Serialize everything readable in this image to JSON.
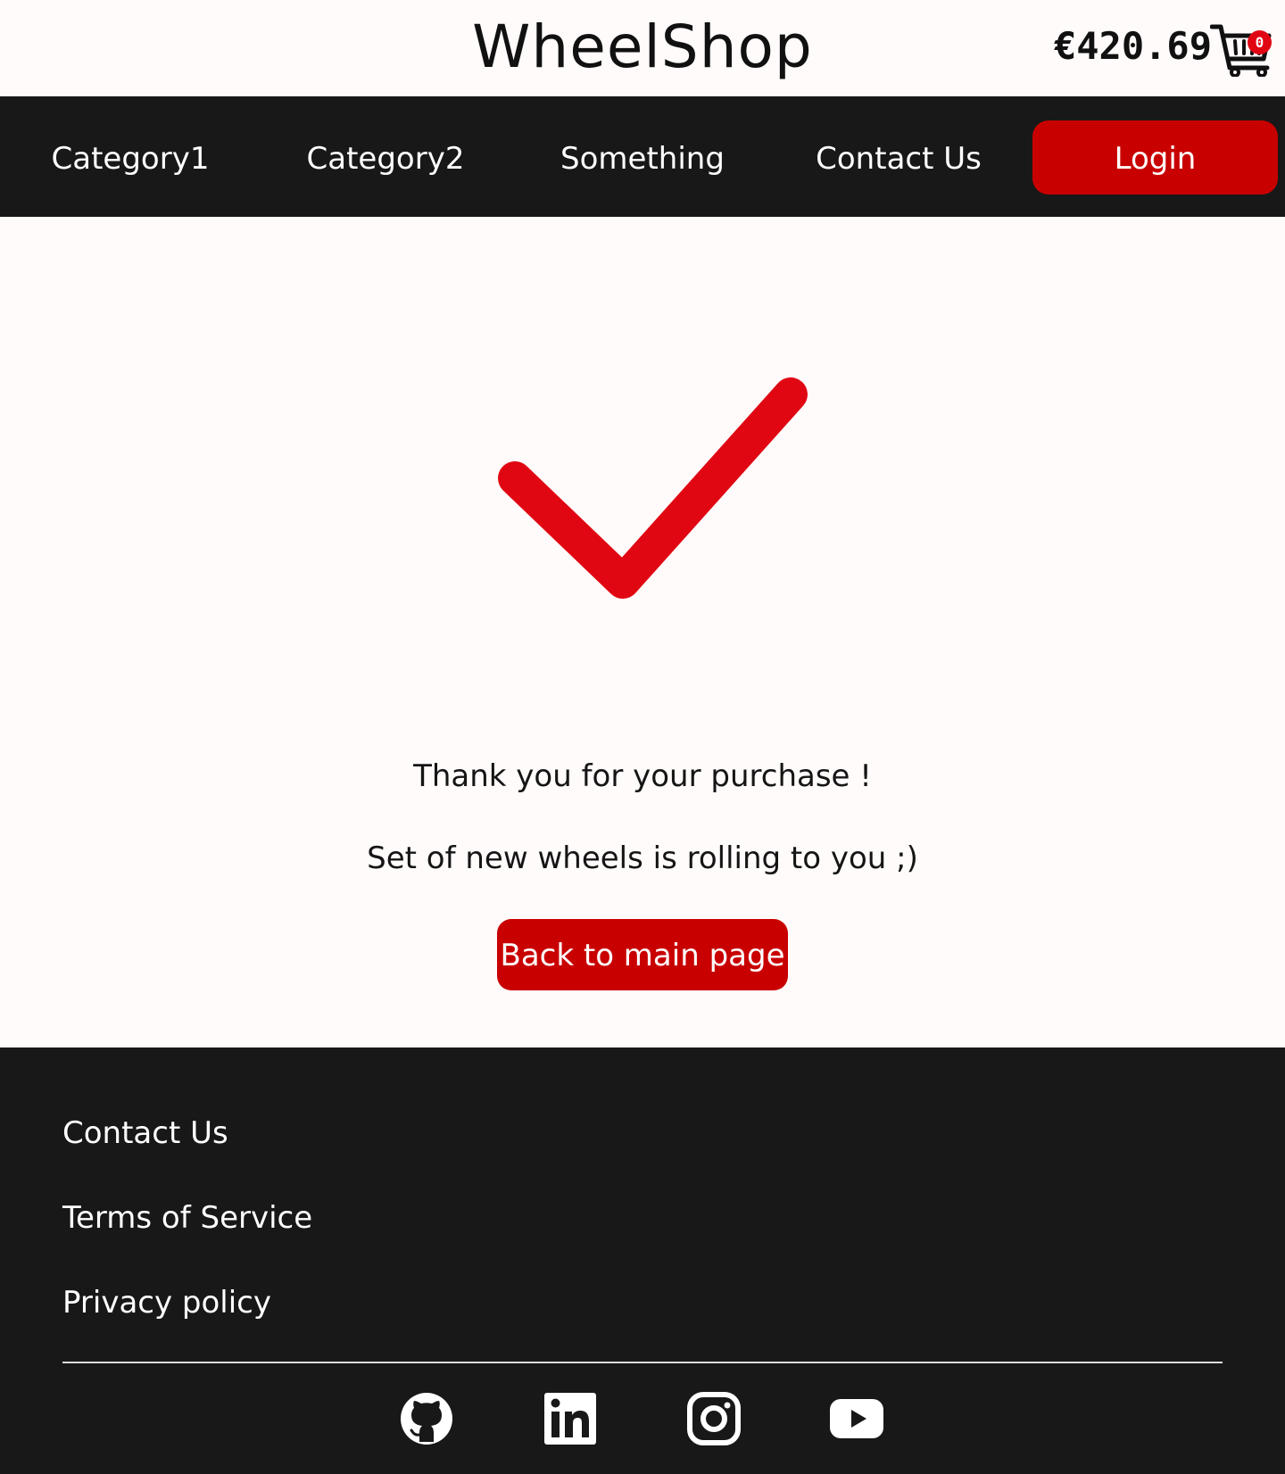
{
  "header": {
    "logo": "WheelShop",
    "cart_total": "€420.69",
    "cart_count": "0"
  },
  "nav": {
    "items": [
      {
        "label": "Category1"
      },
      {
        "label": "Category2"
      },
      {
        "label": "Something"
      },
      {
        "label": "Contact Us"
      }
    ],
    "login_label": "Login"
  },
  "main": {
    "line1": "Thank you for your purchase !",
    "line2": "Set of new wheels is rolling to you ;)",
    "back_label": "Back to main page"
  },
  "footer": {
    "links": [
      {
        "label": "Contact Us"
      },
      {
        "label": "Terms of Service"
      },
      {
        "label": "Privacy policy"
      }
    ],
    "social_icons": [
      "github-icon",
      "linkedin-icon",
      "instagram-icon",
      "youtube-icon"
    ]
  },
  "colors": {
    "accent": "#c90000",
    "check": "#e00713",
    "dark": "#181818",
    "background": "#fffbfa"
  }
}
